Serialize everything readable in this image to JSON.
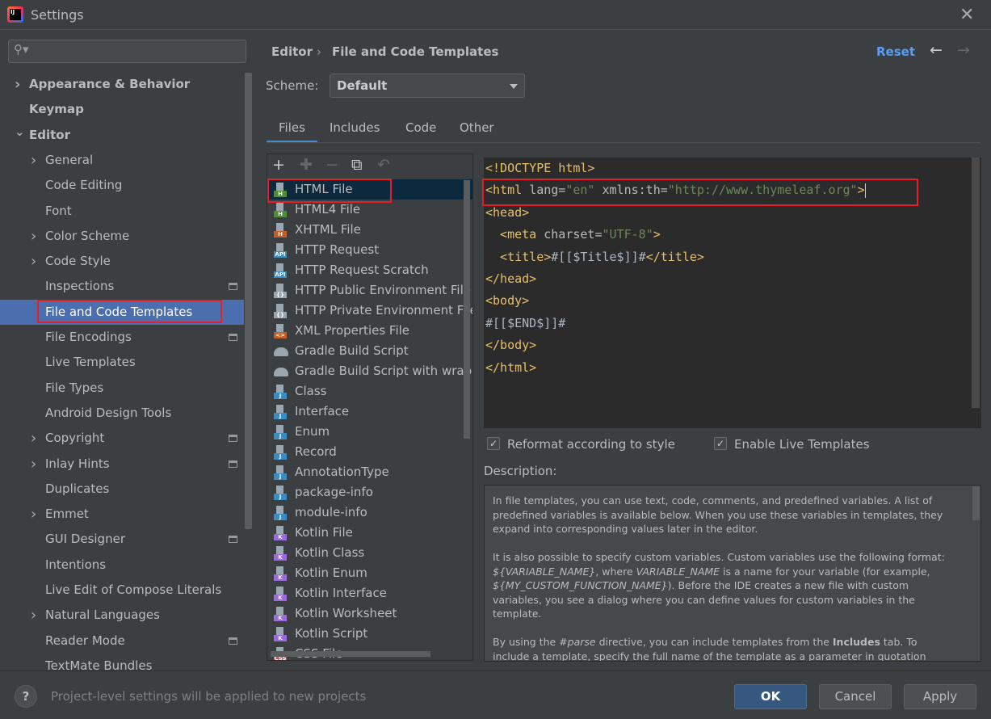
{
  "window": {
    "title": "Settings"
  },
  "sidebar": {
    "items": [
      {
        "label": "Appearance & Behavior",
        "level": 0,
        "chev": "right",
        "bold": true
      },
      {
        "label": "Keymap",
        "level": 0,
        "bold": true
      },
      {
        "label": "Editor",
        "level": 0,
        "chev": "down",
        "bold": true
      },
      {
        "label": "General",
        "level": 1,
        "chev": "right"
      },
      {
        "label": "Code Editing",
        "level": 1
      },
      {
        "label": "Font",
        "level": 1
      },
      {
        "label": "Color Scheme",
        "level": 1,
        "chev": "right"
      },
      {
        "label": "Code Style",
        "level": 1,
        "chev": "right"
      },
      {
        "label": "Inspections",
        "level": 1,
        "gear": true
      },
      {
        "label": "File and Code Templates",
        "level": 1,
        "selected": true
      },
      {
        "label": "File Encodings",
        "level": 1,
        "gear": true
      },
      {
        "label": "Live Templates",
        "level": 1
      },
      {
        "label": "File Types",
        "level": 1
      },
      {
        "label": "Android Design Tools",
        "level": 1
      },
      {
        "label": "Copyright",
        "level": 1,
        "chev": "right",
        "gear": true
      },
      {
        "label": "Inlay Hints",
        "level": 1,
        "chev": "right",
        "gear": true
      },
      {
        "label": "Duplicates",
        "level": 1
      },
      {
        "label": "Emmet",
        "level": 1,
        "chev": "right"
      },
      {
        "label": "GUI Designer",
        "level": 1,
        "gear": true
      },
      {
        "label": "Intentions",
        "level": 1
      },
      {
        "label": "Live Edit of Compose Literals",
        "level": 1
      },
      {
        "label": "Natural Languages",
        "level": 1,
        "chev": "right"
      },
      {
        "label": "Reader Mode",
        "level": 1,
        "gear": true
      },
      {
        "label": "TextMate Bundles",
        "level": 1
      }
    ]
  },
  "header": {
    "breadcrumb": [
      "Editor",
      "File and Code Templates"
    ],
    "reset": "Reset",
    "back": "←",
    "forward": "→"
  },
  "scheme": {
    "label": "Scheme:",
    "value": "Default"
  },
  "tabs": [
    {
      "label": "Files",
      "active": true
    },
    {
      "label": "Includes"
    },
    {
      "label": "Code"
    },
    {
      "label": "Other"
    }
  ],
  "toolbar": {
    "add": "+",
    "add_child": "✚",
    "remove": "−",
    "copy": "⧉",
    "reset": "↶"
  },
  "templates": [
    {
      "label": "HTML File",
      "icon": "html",
      "selected": true
    },
    {
      "label": "HTML4 File",
      "icon": "html"
    },
    {
      "label": "XHTML File",
      "icon": "xhtml"
    },
    {
      "label": "HTTP Request",
      "icon": "api"
    },
    {
      "label": "HTTP Request Scratch",
      "icon": "api"
    },
    {
      "label": "HTTP Public Environment File",
      "icon": "env"
    },
    {
      "label": "HTTP Private Environment File",
      "icon": "env"
    },
    {
      "label": "XML Properties File",
      "icon": "xml"
    },
    {
      "label": "Gradle Build Script",
      "icon": "gradle"
    },
    {
      "label": "Gradle Build Script with wrapper",
      "icon": "gradle"
    },
    {
      "label": "Class",
      "icon": "java"
    },
    {
      "label": "Interface",
      "icon": "java"
    },
    {
      "label": "Enum",
      "icon": "java"
    },
    {
      "label": "Record",
      "icon": "java"
    },
    {
      "label": "AnnotationType",
      "icon": "java"
    },
    {
      "label": "package-info",
      "icon": "java"
    },
    {
      "label": "module-info",
      "icon": "java"
    },
    {
      "label": "Kotlin File",
      "icon": "kotlin"
    },
    {
      "label": "Kotlin Class",
      "icon": "kotlin"
    },
    {
      "label": "Kotlin Enum",
      "icon": "kotlin"
    },
    {
      "label": "Kotlin Interface",
      "icon": "kotlin"
    },
    {
      "label": "Kotlin Worksheet",
      "icon": "kotlin"
    },
    {
      "label": "Kotlin Script",
      "icon": "kotlin"
    },
    {
      "label": "CSS File",
      "icon": "css"
    }
  ],
  "icon_colors": {
    "html": "#4d8f35",
    "xhtml": "#c75c28",
    "api": "#3a8cc4",
    "env": "#9aa7b0",
    "xml": "#c75c28",
    "gradle": "#9aa7b0",
    "java": "#3a8cc4",
    "kotlin": "#9c6ade",
    "css": "#c74a4a"
  },
  "editor": {
    "lines": [
      [
        [
          "t",
          "<!DOCTYPE html>"
        ]
      ],
      [
        [
          "t",
          "<html "
        ],
        [
          "a",
          "lang="
        ],
        [
          "s",
          "\"en\""
        ],
        [
          "a",
          " xmlns:th="
        ],
        [
          "s",
          "\"http://www.thymeleaf.org\""
        ],
        [
          "t",
          ">"
        ]
      ],
      [
        [
          "t",
          "<head>"
        ]
      ],
      [
        [
          "t",
          "  <meta "
        ],
        [
          "a",
          "charset="
        ],
        [
          "s",
          "\"UTF-8\""
        ],
        [
          "t",
          ">"
        ]
      ],
      [
        [
          "t",
          "  <title>"
        ],
        [
          "x",
          "#[[$Title$]]#"
        ],
        [
          "t",
          "</title>"
        ]
      ],
      [
        [
          "t",
          "</head>"
        ]
      ],
      [
        [
          "t",
          "<body>"
        ]
      ],
      [
        [
          "x",
          "#[[$END$]]#"
        ]
      ],
      [
        [
          "t",
          "</body>"
        ]
      ],
      [
        [
          "t",
          "</html>"
        ]
      ]
    ]
  },
  "options": {
    "reformat": {
      "label": "Reformat according to style",
      "checked": true
    },
    "live_templates": {
      "label": "Enable Live Templates",
      "checked": true
    }
  },
  "description": {
    "label": "Description:",
    "p1": "In file templates, you can use text, code, comments, and predefined variables. A list of predefined variables is available below. When you use these variables in templates, they expand into corresponding values later in the editor.",
    "p2a": "It is also possible to specify custom variables. Custom variables use the following format: ",
    "p2b": "${VARIABLE_NAME}",
    "p2c": ", where ",
    "p2d": "VARIABLE_NAME",
    "p2e": " is a name for your variable (for example, ",
    "p2f": "${MY_CUSTOM_FUNCTION_NAME}",
    "p2g": "). Before the IDE creates a new file with custom variables, you see a dialog where you can define values for custom variables in the template.",
    "p3a": "By using the ",
    "p3b": "#parse",
    "p3c": " directive, you can include templates from the ",
    "p3d": "Includes",
    "p3e": " tab. To include a template, specify the full name of the template as a parameter in quotation marks (for"
  },
  "footer": {
    "help": "?",
    "note": "Project-level settings will be applied to new projects",
    "ok": "OK",
    "cancel": "Cancel",
    "apply": "Apply"
  }
}
